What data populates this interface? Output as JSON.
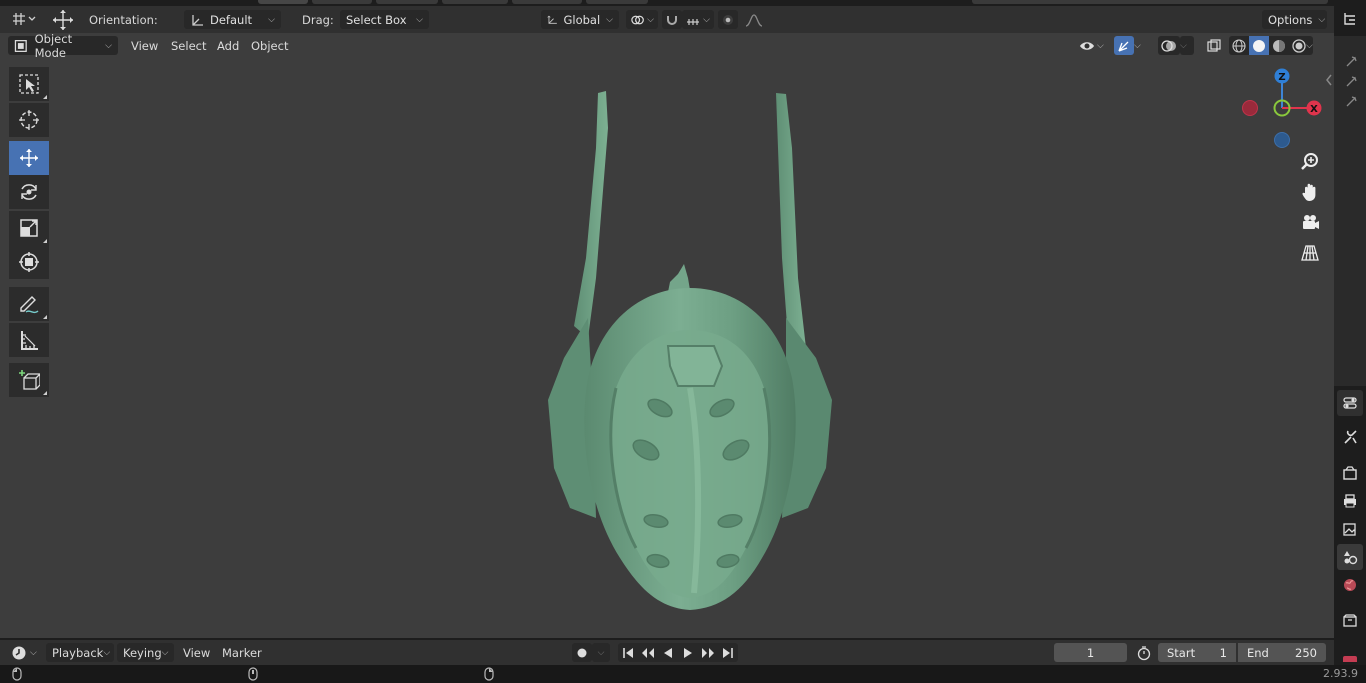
{
  "tool_settings": {
    "orientation_label": "Orientation:",
    "orientation_value": "Default",
    "drag_label": "Drag:",
    "drag_value": "Select Box",
    "transform_orientation": "Global",
    "options_label": "Options"
  },
  "viewport_header": {
    "mode": "Object Mode",
    "menus": [
      "View",
      "Select",
      "Add",
      "Object"
    ]
  },
  "toolbar": {
    "tools": [
      "select-box",
      "cursor",
      "move",
      "rotate",
      "scale",
      "transform",
      "annotate",
      "measure",
      "add-cube"
    ],
    "active_tool": "move"
  },
  "gizmo": {
    "axes": [
      "Z",
      "X"
    ]
  },
  "timeline": {
    "menus": [
      "Playback",
      "Keying",
      "View",
      "Marker"
    ],
    "current_frame": "1",
    "start_label": "Start",
    "start_value": "1",
    "end_label": "End",
    "end_value": "250"
  },
  "statusbar": {
    "version": "2.93.9"
  },
  "colors": {
    "accent": "#4772b3",
    "viewport_bg": "#3d3d3d",
    "model": "#6fa386",
    "axis_x": "#e0344c",
    "axis_y": "#7db52b",
    "axis_z": "#3d84d6"
  }
}
